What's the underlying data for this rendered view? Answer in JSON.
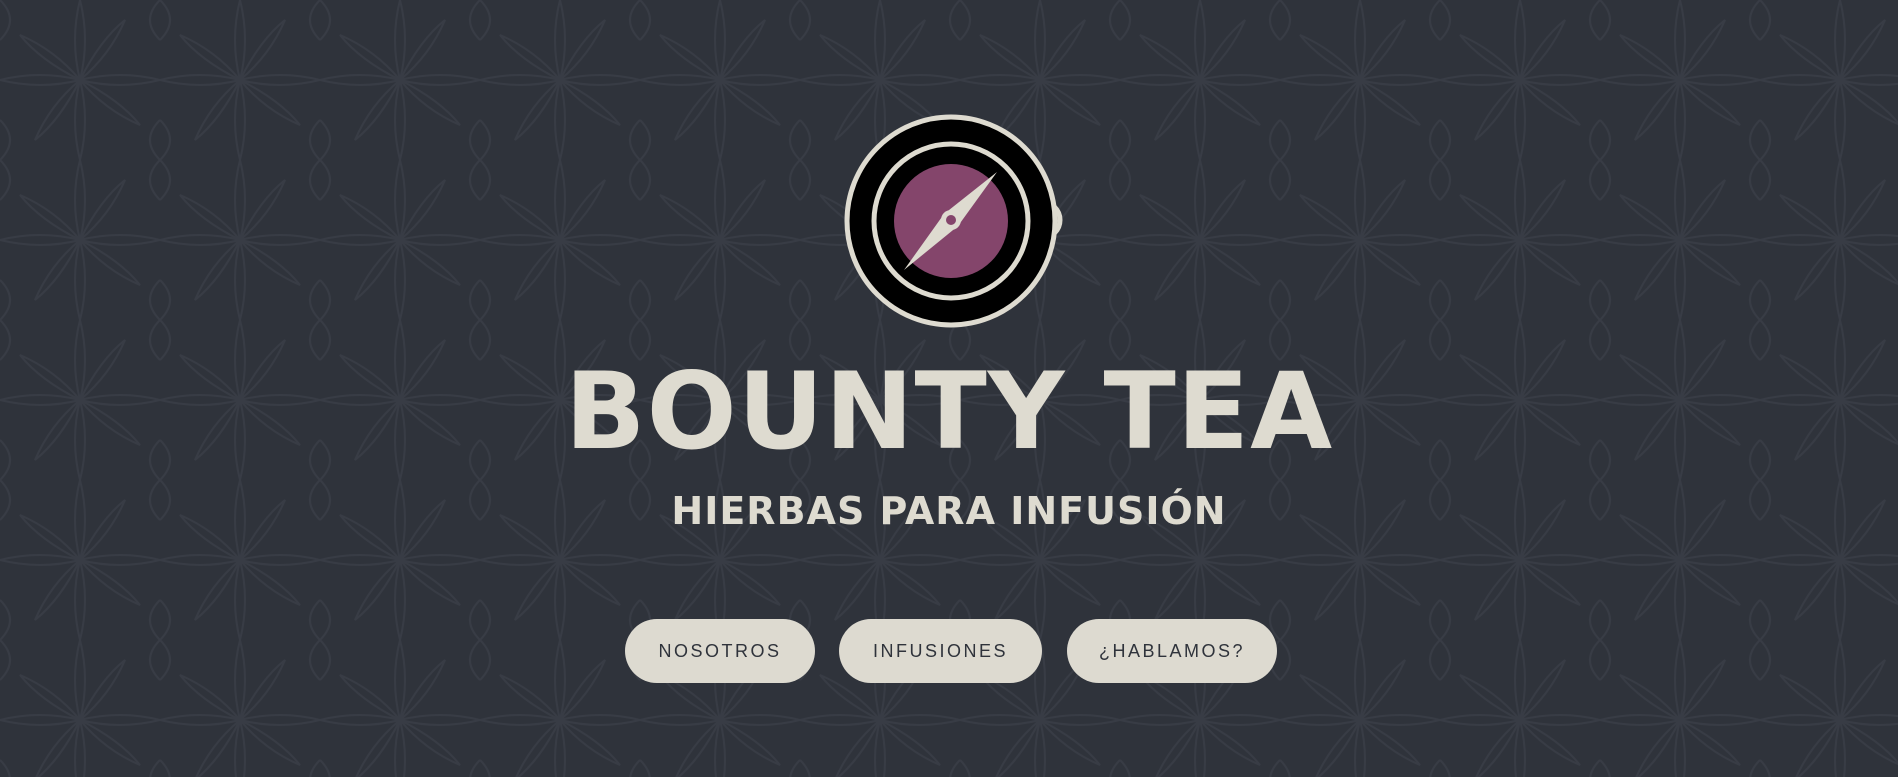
{
  "brand": {
    "title": "BOUNTY TEA",
    "subtitle": "HIERBAS PARA INFUSIÓN",
    "logo_icon": "teacup-compass-icon"
  },
  "nav": {
    "items": [
      {
        "label": "NOSOTROS"
      },
      {
        "label": "INFUSIONES"
      },
      {
        "label": "¿HABLAMOS?"
      }
    ]
  },
  "colors": {
    "background": "#2f333b",
    "pattern": "#383c45",
    "text": "#dedbd0",
    "button_bg": "#dddad0",
    "button_text": "#2f333b",
    "accent": "#84456b"
  }
}
